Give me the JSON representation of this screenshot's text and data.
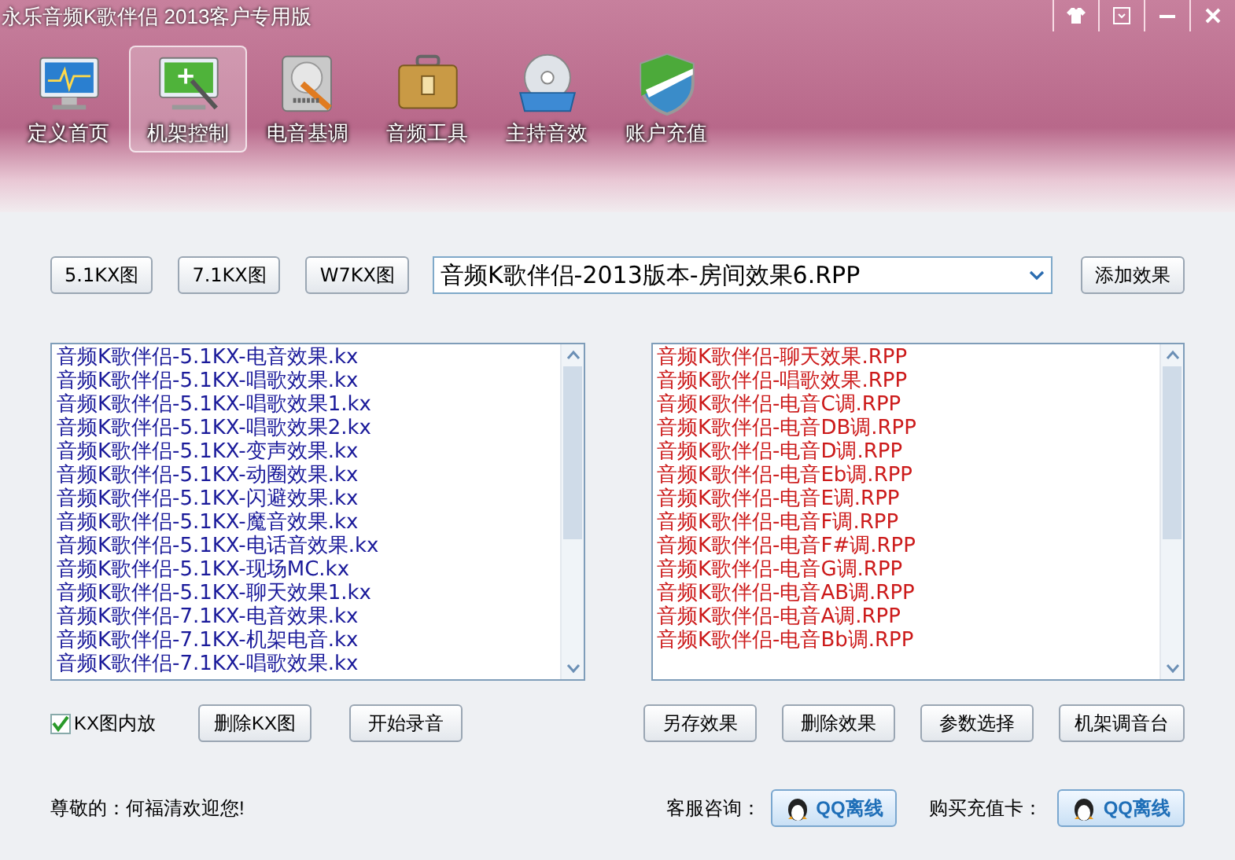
{
  "window": {
    "title": "永乐音频K歌伴侣 2013客户专用版"
  },
  "nav": [
    {
      "label": "定义首页",
      "selected": false,
      "kind": "monitor"
    },
    {
      "label": "机架控制",
      "selected": true,
      "kind": "rack"
    },
    {
      "label": "电音基调",
      "selected": false,
      "kind": "disk"
    },
    {
      "label": "音频工具",
      "selected": false,
      "kind": "case"
    },
    {
      "label": "主持音效",
      "selected": false,
      "kind": "cd"
    },
    {
      "label": "账户充值",
      "selected": false,
      "kind": "shield"
    }
  ],
  "toolbar": {
    "buttons": [
      "5.1KX图",
      "7.1KX图",
      "W7KX图"
    ],
    "effect_select": {
      "value": "音频K歌伴侣-2013版本-房间效果6.RPP"
    },
    "add_button": "添加效果"
  },
  "kx_list": [
    "音频K歌伴侣-5.1KX-电音效果.kx",
    "音频K歌伴侣-5.1KX-唱歌效果.kx",
    "音频K歌伴侣-5.1KX-唱歌效果1.kx",
    "音频K歌伴侣-5.1KX-唱歌效果2.kx",
    "音频K歌伴侣-5.1KX-变声效果.kx",
    "音频K歌伴侣-5.1KX-动圈效果.kx",
    "音频K歌伴侣-5.1KX-闪避效果.kx",
    "音频K歌伴侣-5.1KX-魔音效果.kx",
    "音频K歌伴侣-5.1KX-电话音效果.kx",
    "音频K歌伴侣-5.1KX-现场MC.kx",
    "音频K歌伴侣-5.1KX-聊天效果1.kx",
    "音频K歌伴侣-7.1KX-电音效果.kx",
    "音频K歌伴侣-7.1KX-机架电音.kx",
    "音频K歌伴侣-7.1KX-唱歌效果.kx"
  ],
  "rpp_list": [
    "音频K歌伴侣-聊天效果.RPP",
    "音频K歌伴侣-唱歌效果.RPP",
    "音频K歌伴侣-电音C调.RPP",
    "音频K歌伴侣-电音DB调.RPP",
    "音频K歌伴侣-电音D调.RPP",
    "音频K歌伴侣-电音Eb调.RPP",
    "音频K歌伴侣-电音E调.RPP",
    "音频K歌伴侣-电音F调.RPP",
    "音频K歌伴侣-电音F#调.RPP",
    "音频K歌伴侣-电音G调.RPP",
    "音频K歌伴侣-电音AB调.RPP",
    "音频K歌伴侣-电音A调.RPP",
    "音频K歌伴侣-电音Bb调.RPP"
  ],
  "actions": {
    "checkbox": {
      "label": "KX图内放",
      "checked": true
    },
    "left_buttons": [
      "删除KX图",
      "开始录音"
    ],
    "right_buttons": [
      "另存效果",
      "删除效果",
      "参数选择",
      "机架调音台"
    ]
  },
  "footer": {
    "welcome": "尊敬的：何福清欢迎您!",
    "service_label": "客服咨询：",
    "service_button": "QQ离线",
    "buy_label": "购买充值卡：",
    "buy_button": "QQ离线"
  }
}
